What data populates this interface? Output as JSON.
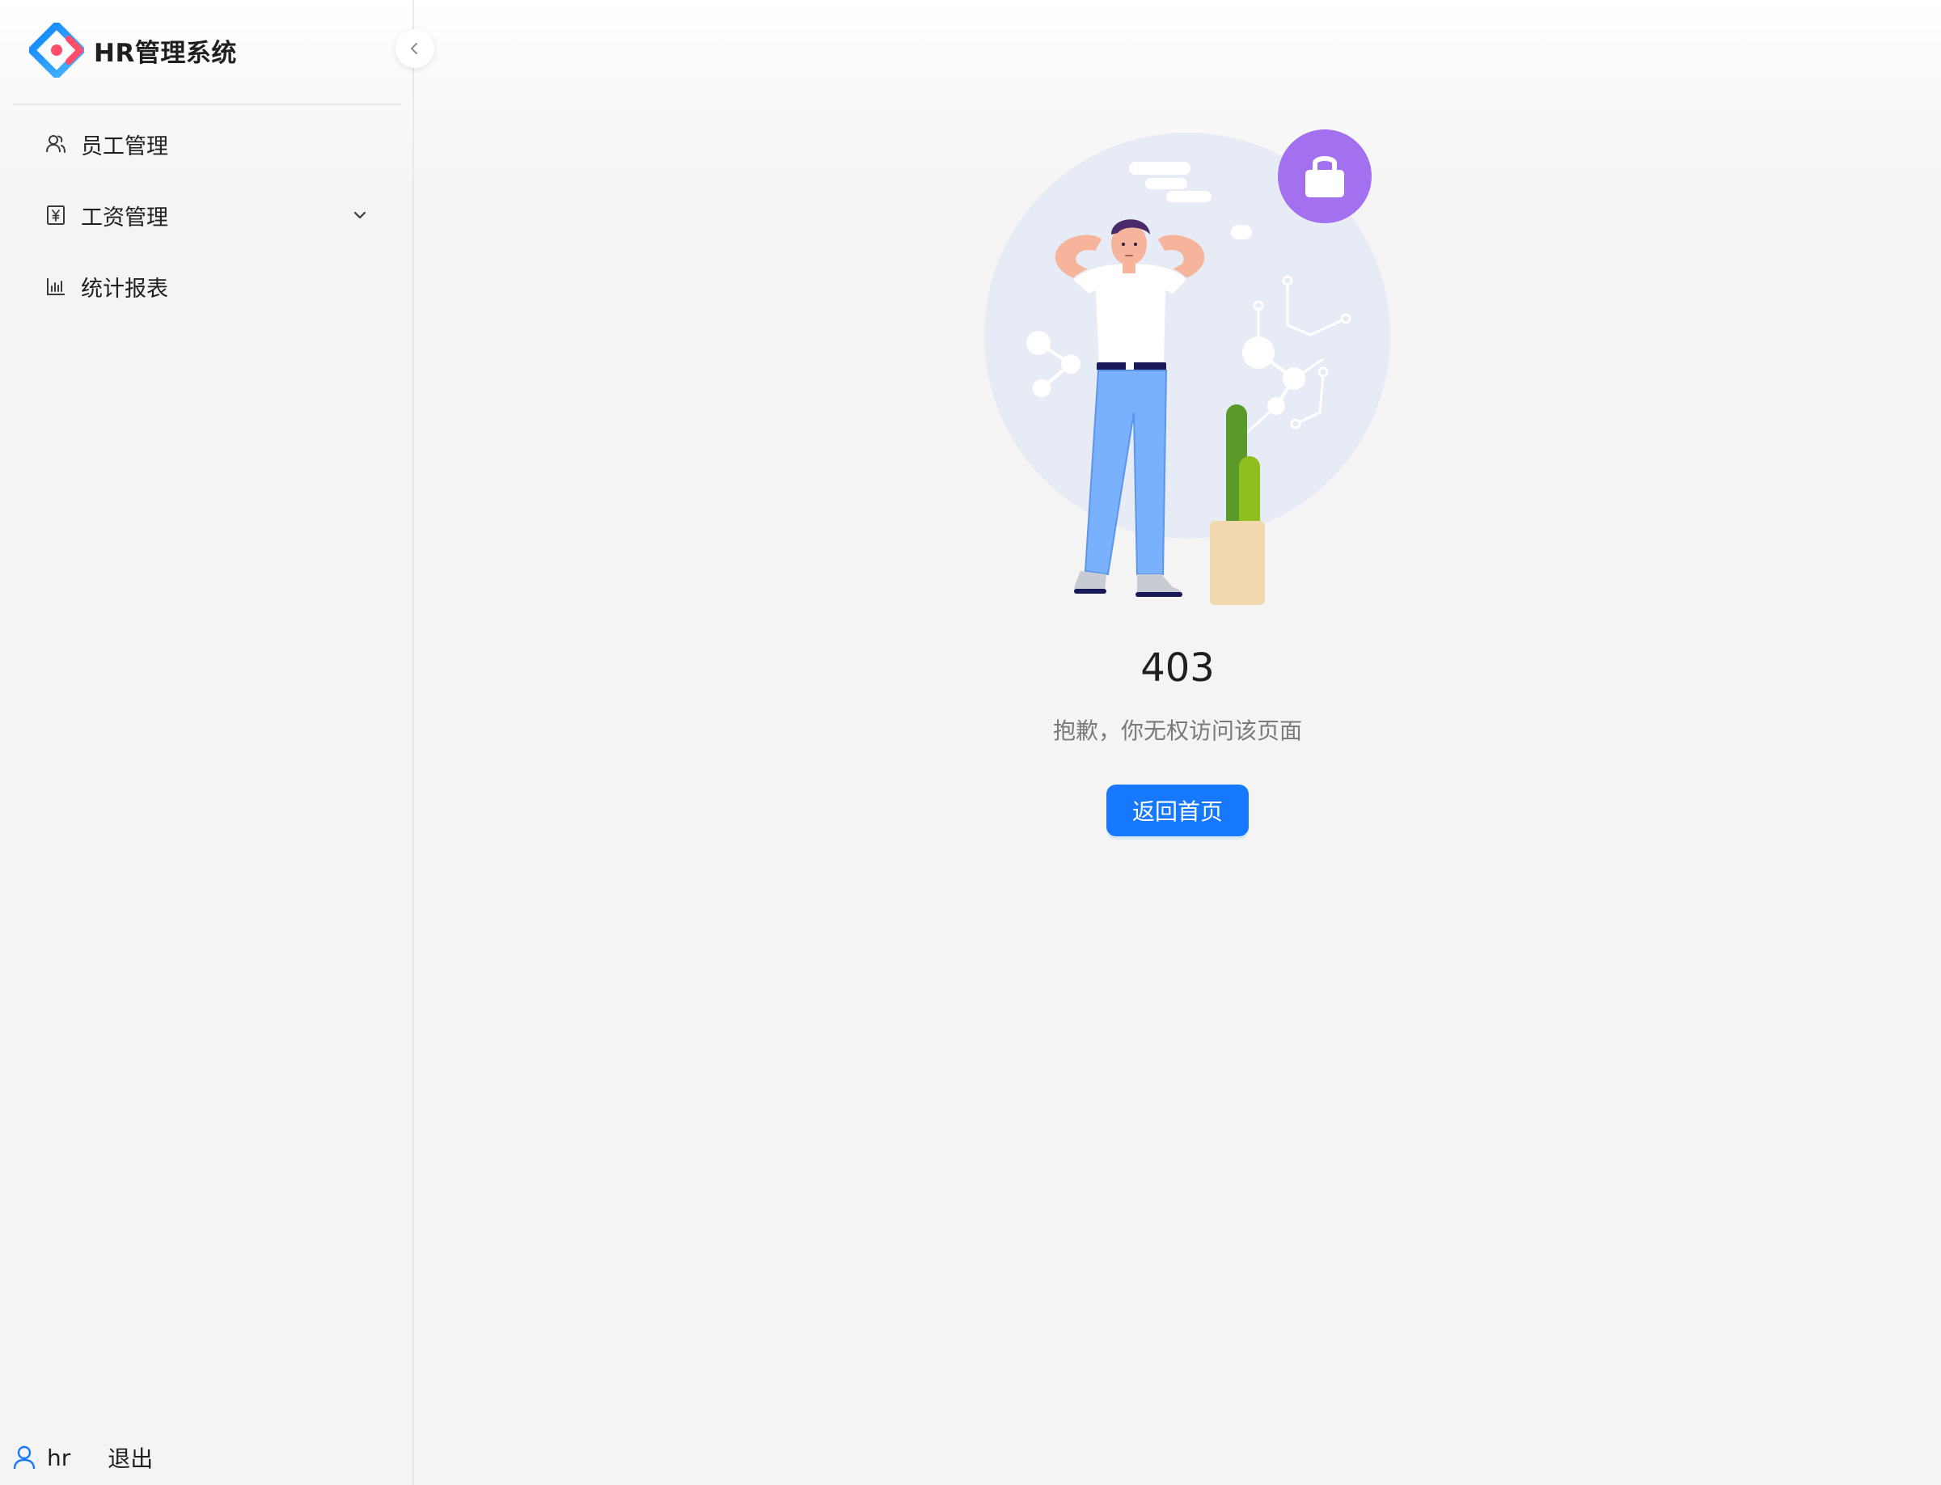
{
  "app": {
    "title": "HR管理系统"
  },
  "sidebar": {
    "items": [
      {
        "label": "员工管理",
        "icon": "user-group-icon"
      },
      {
        "label": "工资管理",
        "icon": "salary-icon",
        "has_submenu": true
      },
      {
        "label": "统计报表",
        "icon": "bar-chart-icon"
      }
    ]
  },
  "user": {
    "name": "hr",
    "logout_label": "退出"
  },
  "result": {
    "status_code": "403",
    "message": "抱歉，你无权访问该页面",
    "button_label": "返回首页"
  },
  "colors": {
    "primary": "#1677ff",
    "lock_badge": "#a370f0",
    "background_circle": "#e6ebf5"
  }
}
